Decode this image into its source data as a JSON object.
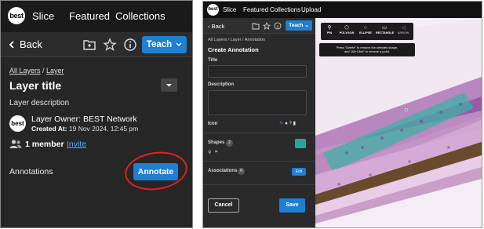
{
  "left": {
    "logo": "best",
    "nav": [
      "Slice",
      "Featured",
      "Collections"
    ],
    "back_label": "Back",
    "teach_label": "Teach",
    "breadcrumb": [
      "All Layers",
      "Layer"
    ],
    "layer_title": "Layer title",
    "layer_description": "Layer description",
    "owner_label": "Layer Owner: BEST Network",
    "created_prefix": "Created At:",
    "created_value": "19 Nov 2024, 12:45 pm",
    "member_count": "1 member",
    "invite_label": "Invite",
    "annotations_label": "Annotations",
    "annotate_label": "Annotate",
    "accent": "#1e7fd3",
    "highlight_color": "#e02020"
  },
  "right": {
    "logo": "best",
    "nav": [
      "Slice",
      "Featured",
      "Collections",
      "Upload"
    ],
    "back_label": "Back",
    "teach_label": "Teach",
    "breadcrumb": "All Layers / Layer / Annotation",
    "heading": "Create Annotation",
    "title_label": "Title",
    "description_label": "Description",
    "icon_label": "Icon",
    "shapes_label": "Shapes",
    "shapes_count": "2",
    "associations_label": "Associations",
    "associations_count": "0",
    "edit_label": "Edit",
    "cancel_label": "Cancel",
    "save_label": "Save",
    "tools": [
      {
        "icon": "pin-icon",
        "label": "PIN"
      },
      {
        "icon": "polygon-icon",
        "label": "POLYGON"
      },
      {
        "icon": "ellipse-icon",
        "label": "ELLIPSE"
      },
      {
        "icon": "rectangle-icon",
        "label": "RECTANGLE"
      },
      {
        "icon": "arrow-icon",
        "label": "ARROW"
      }
    ],
    "tooltip_line1": "Press \"Delete\" to remove the selected shape,",
    "tooltip_line2": "and \"Alt+Click\" to remove a point.",
    "shape_color": "#2aa39a"
  }
}
